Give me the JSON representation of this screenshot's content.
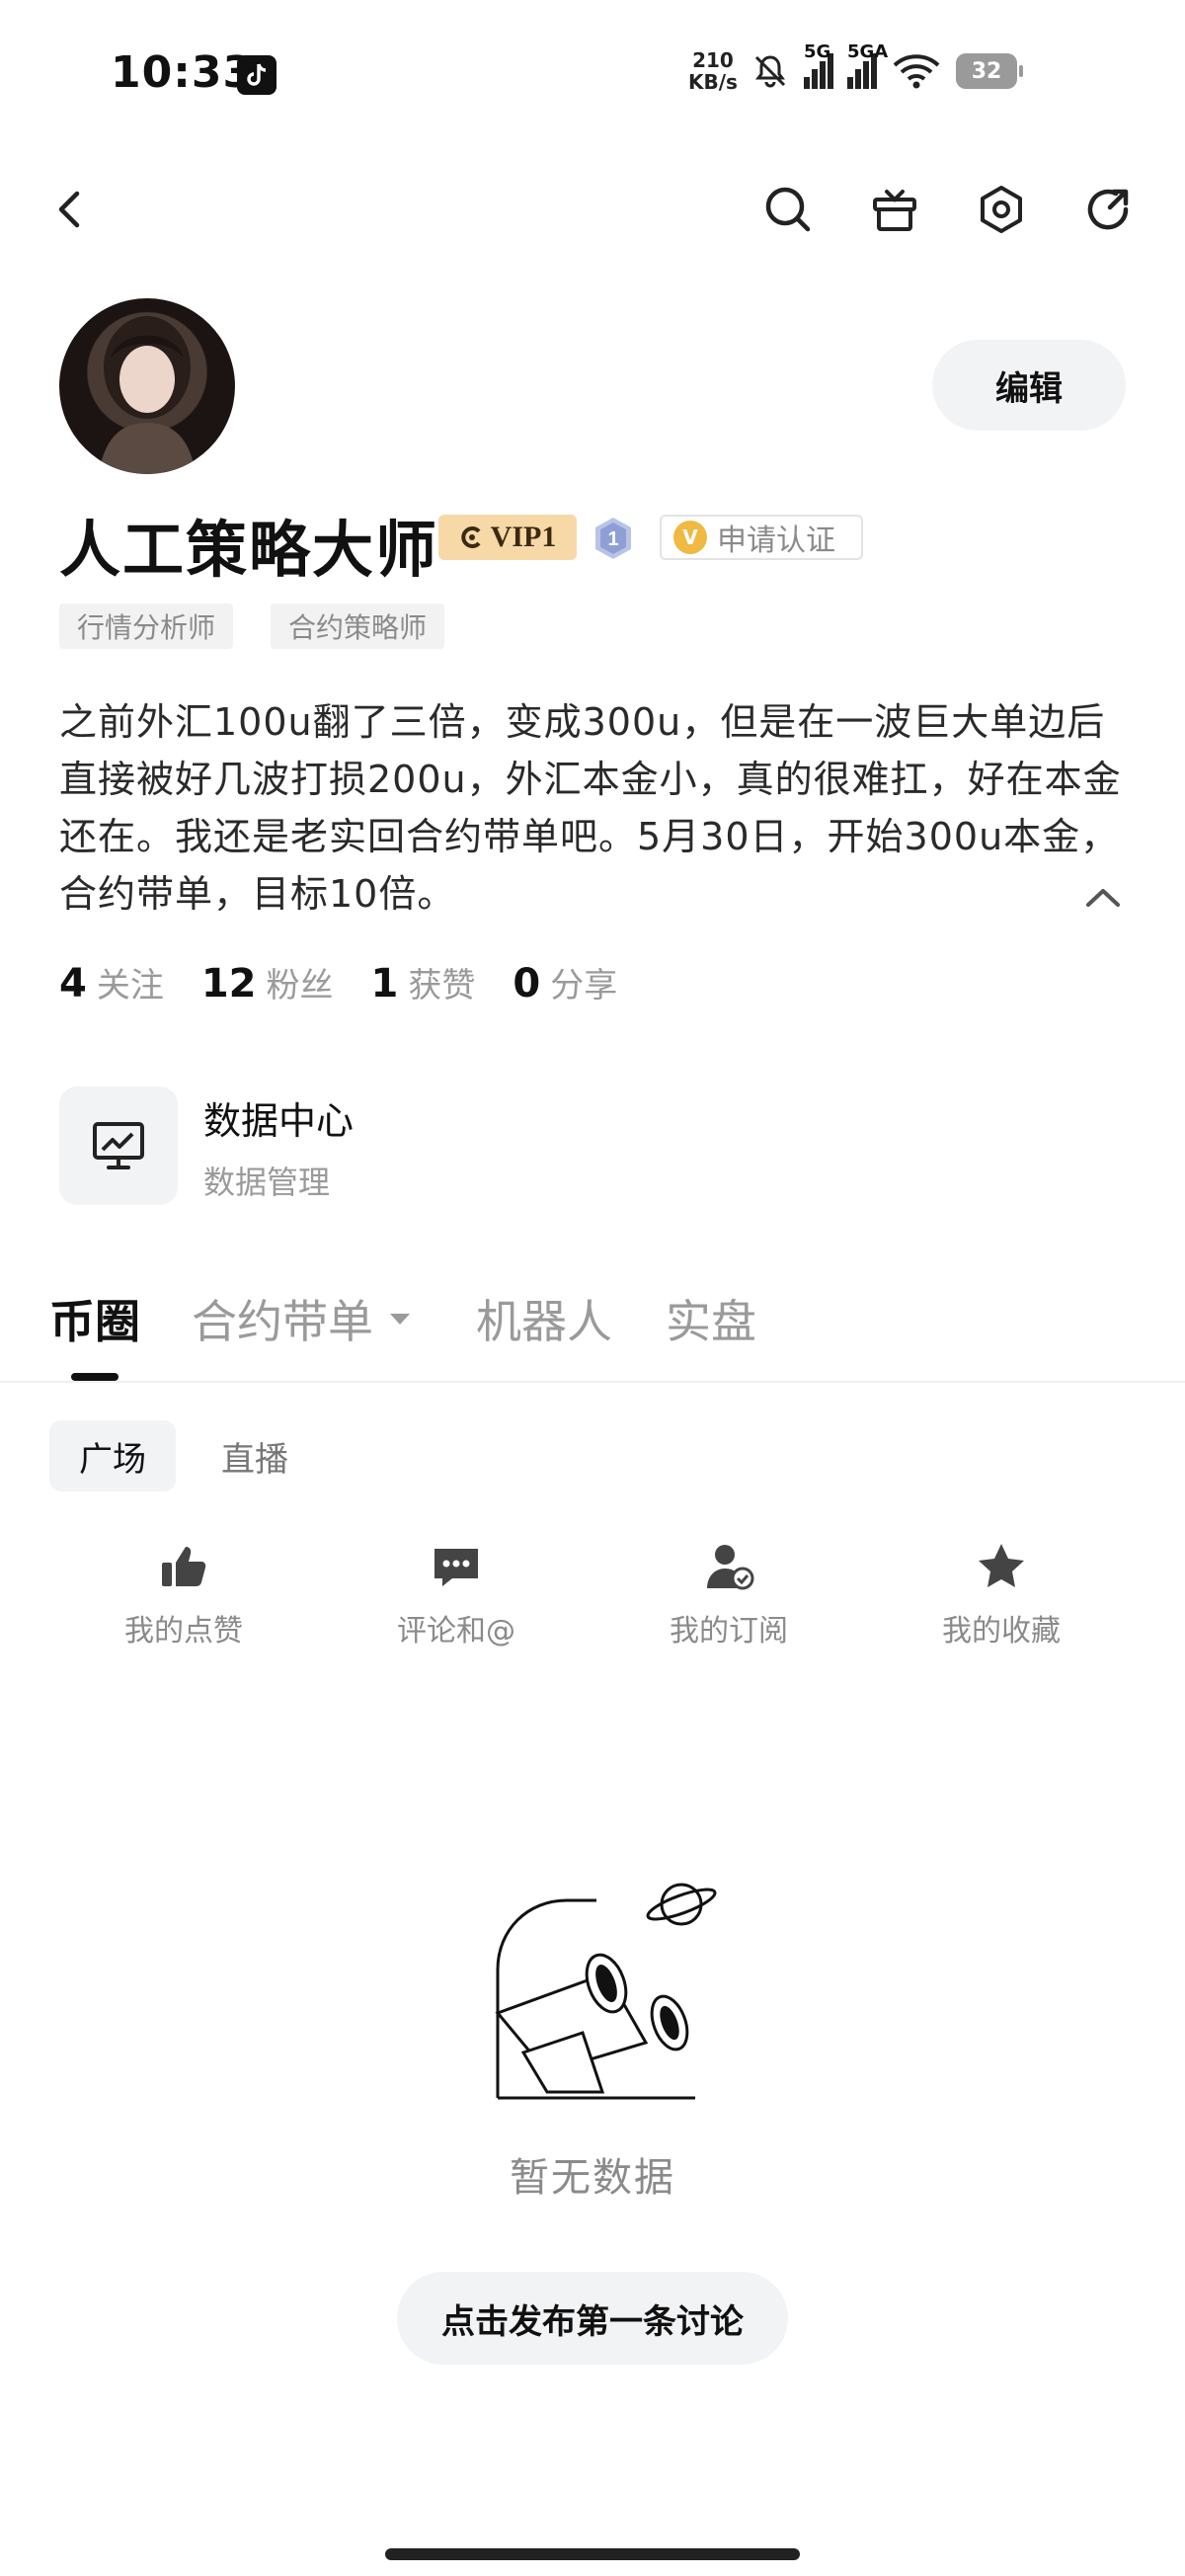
{
  "status_bar": {
    "time": "10:33",
    "net_speed_value": "210",
    "net_speed_unit": "KB/s",
    "signal_1": "5G",
    "signal_2": "5GA",
    "battery": "32"
  },
  "top_nav": {
    "icons": [
      "back-icon",
      "search-icon",
      "gift-icon",
      "settings-icon",
      "share-icon"
    ]
  },
  "profile": {
    "edit_label": "编辑",
    "name": "人工策略大师",
    "vip_label": "VIP1",
    "level": "1",
    "cert_label": "申请认证",
    "cert_icon_text": "V",
    "tags": [
      "行情分析师",
      "合约策略师"
    ],
    "bio": "之前外汇100u翻了三倍，变成300u，但是在一波巨大单边后直接被好几波打损200u，外汇本金小，真的很难扛，好在本金还在。我还是老实回合约带单吧。5月30日，开始300u本金，合约带单，目标10倍。"
  },
  "stats": [
    {
      "value": "4",
      "label": "关注"
    },
    {
      "value": "12",
      "label": "粉丝"
    },
    {
      "value": "1",
      "label": "获赞"
    },
    {
      "value": "0",
      "label": "分享"
    }
  ],
  "data_center": {
    "title": "数据中心",
    "subtitle": "数据管理"
  },
  "tabs": [
    {
      "label": "币圈",
      "active": true
    },
    {
      "label": "合约带单",
      "active": false
    },
    {
      "label": "机器人",
      "active": false
    },
    {
      "label": "实盘",
      "active": false
    }
  ],
  "subtabs": [
    {
      "label": "广场",
      "active": true
    },
    {
      "label": "直播",
      "active": false
    }
  ],
  "quick_actions": [
    {
      "label": "我的点赞",
      "icon": "thumbs-up-icon"
    },
    {
      "label": "评论和@",
      "icon": "comment-icon"
    },
    {
      "label": "我的订阅",
      "icon": "subscribe-icon"
    },
    {
      "label": "我的收藏",
      "icon": "star-icon"
    }
  ],
  "empty_state": {
    "text": "暂无数据",
    "button": "点击发布第一条讨论"
  },
  "colors": {
    "vip_bg": "#f7d9a8",
    "cert_icon": "#f0b942",
    "chip_bg": "#f2f3f5",
    "muted_text": "#9a9a9a"
  }
}
